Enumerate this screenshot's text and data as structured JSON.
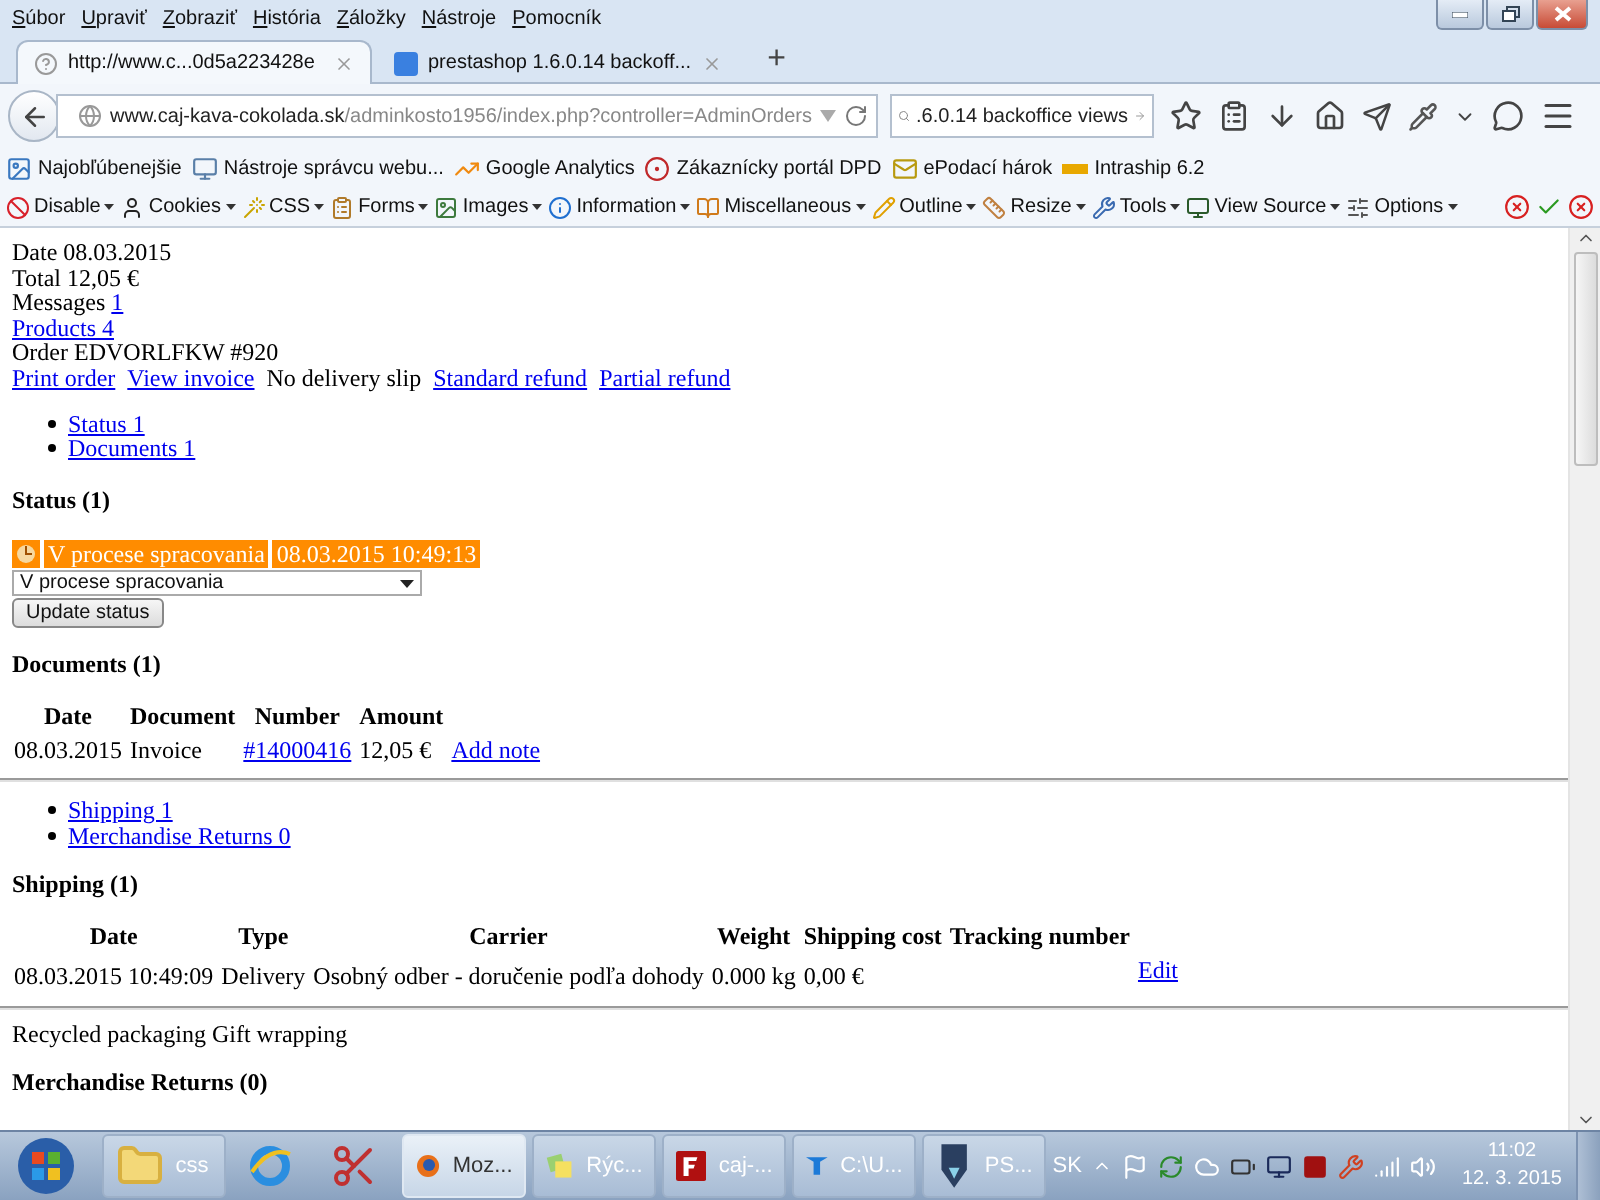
{
  "menu": [
    "Súbor",
    "Upraviť",
    "Zobraziť",
    "História",
    "Záložky",
    "Nástroje",
    "Pomocník"
  ],
  "tabs": [
    {
      "label": "http://www.c...0d5a223428e",
      "selected": true
    },
    {
      "label": "prestashop 1.6.0.14 backoff...",
      "selected": false
    }
  ],
  "new_tab": "+",
  "address_bar": {
    "domain": "www.caj-kava-cokolada.sk",
    "path": "/adminkosto1956/index.php?controller=AdminOrders"
  },
  "search_field": {
    "value": ".6.0.14 backoffice views"
  },
  "bookmarks": [
    "Najobľúbenejšie",
    "Nástroje správcu webu...",
    "Google Analytics",
    "Zákaznícky portál DPD",
    "ePodací hárok",
    "Intraship 6.2"
  ],
  "developer_toolbar": [
    "Disable",
    "Cookies",
    "CSS",
    "Forms",
    "Images",
    "Information",
    "Miscellaneous",
    "Outline",
    "Resize",
    "Tools",
    "View Source",
    "Options"
  ],
  "order": {
    "info": [
      {
        "kind": "text",
        "label": "Date",
        "value": "08.03.2015"
      },
      {
        "kind": "text",
        "label": "Total",
        "value": "12,05 €"
      },
      {
        "kind": "value_link",
        "label": "Messages",
        "value": "1"
      },
      {
        "kind": "link",
        "label": "Products 4"
      },
      {
        "kind": "text",
        "label": "Order",
        "value": "EDVORLFKW #920"
      }
    ],
    "actions": [
      {
        "kind": "link",
        "label": "Print order"
      },
      {
        "kind": "link",
        "label": "View invoice"
      },
      {
        "kind": "text",
        "label": "No delivery slip"
      },
      {
        "kind": "link",
        "label": "Standard refund"
      },
      {
        "kind": "link",
        "label": "Partial refund"
      }
    ],
    "section_links_top": [
      "Status 1",
      "Documents 1"
    ],
    "status": {
      "heading": "Status (1)",
      "history": [
        {
          "name": "V procese spracovania",
          "date": "08.03.2015 10:49:13",
          "color": "#ff8c00"
        }
      ],
      "select_value": "V procese spracovania",
      "button": "Update status"
    },
    "documents": {
      "heading": "Documents (1)",
      "columns": [
        "Date",
        "Document",
        "Number",
        "Amount"
      ],
      "rows": [
        {
          "date": "08.03.2015",
          "document": "Invoice",
          "number": "#14000416",
          "amount": "12,05 €",
          "action": "Add note"
        }
      ]
    },
    "section_links_bottom": [
      "Shipping 1",
      "Merchandise Returns 0"
    ],
    "shipping": {
      "heading": "Shipping (1)",
      "columns": [
        "Date",
        "Type",
        "Carrier",
        "Weight",
        "Shipping cost",
        "Tracking number"
      ],
      "rows": [
        {
          "date": "08.03.2015 10:49:09",
          "type": "Delivery",
          "carrier": "Osobný odber - doručenie podľa dohody",
          "weight": "0.000 kg",
          "cost": "0,00 €",
          "action": "Edit"
        }
      ]
    },
    "extras": "Recycled packaging Gift wrapping",
    "returns_heading": "Merchandise Returns (0)"
  },
  "taskbar": {
    "items": [
      {
        "kind": "folder",
        "label": "css",
        "selected": false
      },
      {
        "kind": "ie",
        "selected": false
      },
      {
        "kind": "snipping",
        "selected": false
      },
      {
        "kind": "firefox",
        "label": "Moz...",
        "selected": true
      },
      {
        "kind": "notes",
        "label": "Rýc...",
        "selected": false
      },
      {
        "kind": "filezilla",
        "label": "caj-...",
        "selected": false
      },
      {
        "kind": "teamviewer",
        "label": "C:\\U...",
        "selected": false
      },
      {
        "kind": "pen",
        "label": "PS...",
        "selected": false
      }
    ],
    "language": "SK",
    "time": "11:02",
    "date": "12. 3. 2015"
  }
}
